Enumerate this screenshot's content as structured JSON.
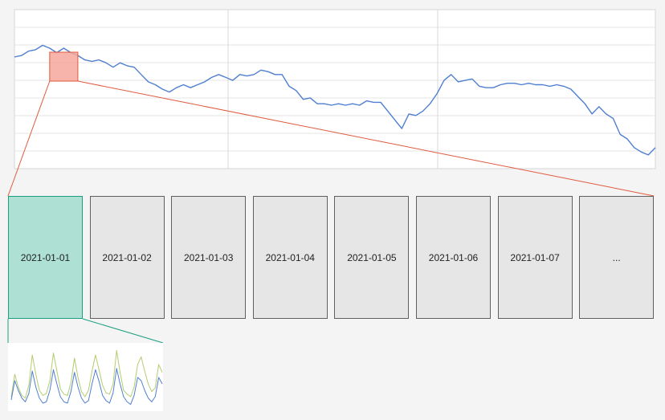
{
  "days": [
    "2021-01-01",
    "2021-01-02",
    "2021-01-03",
    "2021-01-04",
    "2021-01-05",
    "2021-01-06",
    "2021-01-07",
    "..."
  ],
  "selected_index": 0,
  "colors": {
    "main_line": "#4f7fd0",
    "highlight_fill": "#f4a79b",
    "highlight_stroke": "#e05a3c",
    "connector_red": "#e05a3c",
    "selected_box_fill": "#aee0d4",
    "selected_box_stroke": "#1b9e7e",
    "day_box_fill": "#e6e6e6",
    "mini_series_green": "#b5cc6e",
    "mini_series_blue": "#4f7fd0"
  },
  "chart_data": [
    {
      "type": "line",
      "series": [
        {
          "values": [
            0.72,
            0.73,
            0.76,
            0.77,
            0.8,
            0.78,
            0.75,
            0.78,
            0.75,
            0.73,
            0.7,
            0.69,
            0.7,
            0.68,
            0.65,
            0.68,
            0.66,
            0.65,
            0.6,
            0.55,
            0.53,
            0.5,
            0.48,
            0.51,
            0.53,
            0.51,
            0.53,
            0.55,
            0.58,
            0.6,
            0.58,
            0.56,
            0.6,
            0.59,
            0.6,
            0.63,
            0.62,
            0.6,
            0.6,
            0.52,
            0.49,
            0.43,
            0.44,
            0.4,
            0.4,
            0.39,
            0.4,
            0.39,
            0.4,
            0.39,
            0.42,
            0.41,
            0.41,
            0.35,
            0.29,
            0.23,
            0.33,
            0.32,
            0.35,
            0.4,
            0.47,
            0.56,
            0.6,
            0.55,
            0.56,
            0.57,
            0.52,
            0.51,
            0.51,
            0.53,
            0.54,
            0.54,
            0.53,
            0.54,
            0.53,
            0.53,
            0.52,
            0.53,
            0.52,
            0.5,
            0.45,
            0.4,
            0.33,
            0.38,
            0.33,
            0.3,
            0.19,
            0.16,
            0.1,
            0.07,
            0.05,
            0.1
          ]
        }
      ],
      "highlight_range": [
        5,
        9
      ]
    },
    {
      "type": "line",
      "series": [
        {
          "values": [
            0.2,
            0.55,
            0.35,
            0.22,
            0.18,
            0.38,
            0.85,
            0.55,
            0.3,
            0.22,
            0.25,
            0.45,
            0.88,
            0.6,
            0.32,
            0.24,
            0.22,
            0.42,
            0.8,
            0.5,
            0.28,
            0.2,
            0.3,
            0.6,
            0.85,
            0.62,
            0.38,
            0.26,
            0.24,
            0.4,
            0.92,
            0.58,
            0.3,
            0.24,
            0.2,
            0.35,
            0.7,
            0.82,
            0.6,
            0.4,
            0.28,
            0.34,
            0.7,
            0.58
          ]
        },
        {
          "values": [
            0.15,
            0.45,
            0.3,
            0.18,
            0.12,
            0.25,
            0.6,
            0.35,
            0.18,
            0.1,
            0.12,
            0.3,
            0.62,
            0.4,
            0.2,
            0.12,
            0.1,
            0.28,
            0.58,
            0.35,
            0.18,
            0.1,
            0.14,
            0.4,
            0.62,
            0.44,
            0.22,
            0.14,
            0.1,
            0.26,
            0.64,
            0.4,
            0.2,
            0.12,
            0.08,
            0.22,
            0.5,
            0.45,
            0.3,
            0.18,
            0.12,
            0.2,
            0.5,
            0.4
          ]
        }
      ]
    }
  ]
}
